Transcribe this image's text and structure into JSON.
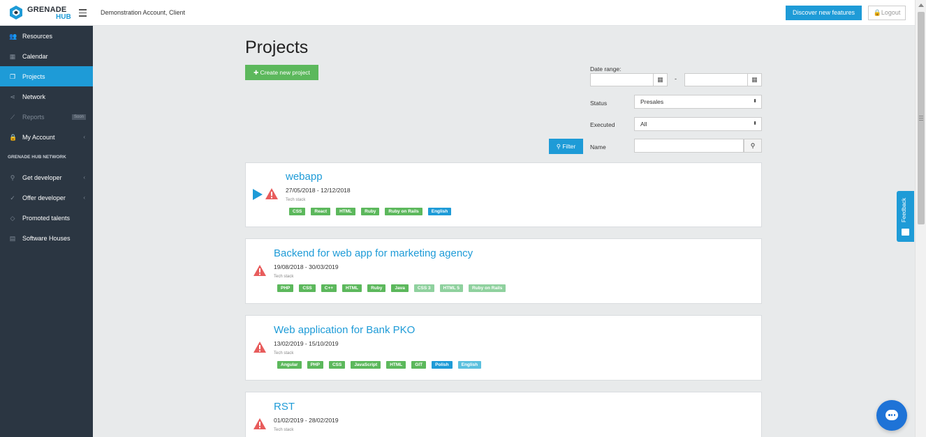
{
  "header": {
    "brand_top": "GRENADE",
    "brand_bottom": "HUB",
    "account": "Demonstration Account, Client",
    "discover_label": "Discover new features",
    "logout_label": "Logout"
  },
  "sidebar": {
    "items": [
      {
        "label": "Resources",
        "icon": "users-icon"
      },
      {
        "label": "Calendar",
        "icon": "calendar-icon"
      },
      {
        "label": "Projects",
        "icon": "projects-icon",
        "active": true
      },
      {
        "label": "Network",
        "icon": "share-icon"
      },
      {
        "label": "Reports",
        "icon": "chart-icon",
        "badge": "Soon"
      },
      {
        "label": "My Account",
        "icon": "lock-icon"
      }
    ],
    "section_header": "GRENADE HUB NETWORK",
    "network_items": [
      {
        "label": "Get developer",
        "icon": "search-icon"
      },
      {
        "label": "Offer developer",
        "icon": "check-circle-icon"
      },
      {
        "label": "Promoted talents",
        "icon": "diamond-icon"
      },
      {
        "label": "Software Houses",
        "icon": "building-icon"
      }
    ]
  },
  "main": {
    "title": "Projects",
    "create_label": "✚ Create new project"
  },
  "filters": {
    "date_range_label": "Date range:",
    "date_from": "",
    "date_to": "",
    "dash": "-",
    "status_label": "Status",
    "status_value": "Presales",
    "executed_label": "Executed",
    "executed_value": "All",
    "filter_label": "Filter",
    "name_label": "Name",
    "name_value": ""
  },
  "projects": [
    {
      "title": "webapp",
      "dates": "27/05/2018 - 12/12/2018",
      "stack_label": "Tech stack",
      "tags": [
        {
          "text": "CSS",
          "color": "#5cb85c"
        },
        {
          "text": "React",
          "color": "#5cb85c"
        },
        {
          "text": "HTML",
          "color": "#5cb85c"
        },
        {
          "text": "Ruby",
          "color": "#5cb85c"
        },
        {
          "text": "Ruby on Rails",
          "color": "#5cb85c"
        },
        {
          "text": "English",
          "color": "#1e9bd7"
        }
      ]
    },
    {
      "title": "Backend for web app for marketing agency",
      "dates": "19/08/2018 - 30/03/2019",
      "stack_label": "Tech stack",
      "tags": [
        {
          "text": "PHP",
          "color": "#5cb85c"
        },
        {
          "text": "CSS",
          "color": "#5cb85c"
        },
        {
          "text": "C++",
          "color": "#5cb85c"
        },
        {
          "text": "HTML",
          "color": "#5cb85c"
        },
        {
          "text": "Ruby",
          "color": "#5cb85c"
        },
        {
          "text": "Java",
          "color": "#5cb85c"
        },
        {
          "text": "CSS 3",
          "color": "#8fd19e"
        },
        {
          "text": "HTML 5",
          "color": "#8fd19e"
        },
        {
          "text": "Ruby on Rails",
          "color": "#8fd19e"
        }
      ]
    },
    {
      "title": "Web application for Bank PKO",
      "dates": "13/02/2019 - 15/10/2019",
      "stack_label": "Tech stack",
      "tags": [
        {
          "text": "Angular",
          "color": "#5cb85c"
        },
        {
          "text": "PHP",
          "color": "#5cb85c"
        },
        {
          "text": "CSS",
          "color": "#5cb85c"
        },
        {
          "text": "JavaScript",
          "color": "#5cb85c"
        },
        {
          "text": "HTML",
          "color": "#5cb85c"
        },
        {
          "text": "GIT",
          "color": "#5cb85c"
        },
        {
          "text": "Polish",
          "color": "#1e9bd7"
        },
        {
          "text": "English",
          "color": "#5bc0de"
        }
      ]
    },
    {
      "title": "RST",
      "dates": "01/02/2019 - 28/02/2019",
      "stack_label": "Tech stack",
      "tags": []
    }
  ],
  "widgets": {
    "feedback_label": "Feedback"
  },
  "colors": {
    "accent": "#1e9bd7",
    "success": "#5cb85c",
    "sidebar_bg": "#2b3642",
    "warning": "#e85c5c"
  }
}
